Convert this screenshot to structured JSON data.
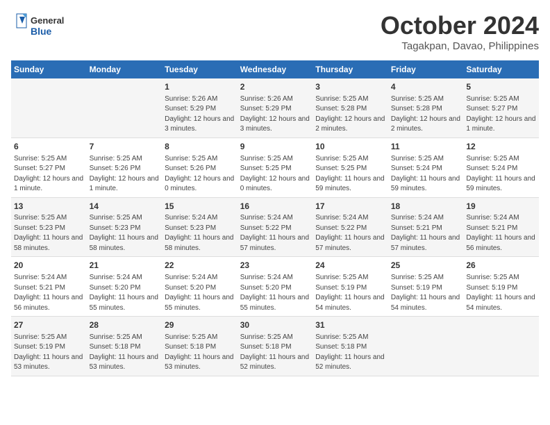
{
  "logo": {
    "line1": "General",
    "line2": "Blue"
  },
  "title": "October 2024",
  "subtitle": "Tagakpan, Davao, Philippines",
  "weekdays": [
    "Sunday",
    "Monday",
    "Tuesday",
    "Wednesday",
    "Thursday",
    "Friday",
    "Saturday"
  ],
  "weeks": [
    [
      {
        "day": "",
        "info": ""
      },
      {
        "day": "",
        "info": ""
      },
      {
        "day": "1",
        "info": "Sunrise: 5:26 AM\nSunset: 5:29 PM\nDaylight: 12 hours and 3 minutes."
      },
      {
        "day": "2",
        "info": "Sunrise: 5:26 AM\nSunset: 5:29 PM\nDaylight: 12 hours and 3 minutes."
      },
      {
        "day": "3",
        "info": "Sunrise: 5:25 AM\nSunset: 5:28 PM\nDaylight: 12 hours and 2 minutes."
      },
      {
        "day": "4",
        "info": "Sunrise: 5:25 AM\nSunset: 5:28 PM\nDaylight: 12 hours and 2 minutes."
      },
      {
        "day": "5",
        "info": "Sunrise: 5:25 AM\nSunset: 5:27 PM\nDaylight: 12 hours and 1 minute."
      }
    ],
    [
      {
        "day": "6",
        "info": "Sunrise: 5:25 AM\nSunset: 5:27 PM\nDaylight: 12 hours and 1 minute."
      },
      {
        "day": "7",
        "info": "Sunrise: 5:25 AM\nSunset: 5:26 PM\nDaylight: 12 hours and 1 minute."
      },
      {
        "day": "8",
        "info": "Sunrise: 5:25 AM\nSunset: 5:26 PM\nDaylight: 12 hours and 0 minutes."
      },
      {
        "day": "9",
        "info": "Sunrise: 5:25 AM\nSunset: 5:25 PM\nDaylight: 12 hours and 0 minutes."
      },
      {
        "day": "10",
        "info": "Sunrise: 5:25 AM\nSunset: 5:25 PM\nDaylight: 11 hours and 59 minutes."
      },
      {
        "day": "11",
        "info": "Sunrise: 5:25 AM\nSunset: 5:24 PM\nDaylight: 11 hours and 59 minutes."
      },
      {
        "day": "12",
        "info": "Sunrise: 5:25 AM\nSunset: 5:24 PM\nDaylight: 11 hours and 59 minutes."
      }
    ],
    [
      {
        "day": "13",
        "info": "Sunrise: 5:25 AM\nSunset: 5:23 PM\nDaylight: 11 hours and 58 minutes."
      },
      {
        "day": "14",
        "info": "Sunrise: 5:25 AM\nSunset: 5:23 PM\nDaylight: 11 hours and 58 minutes."
      },
      {
        "day": "15",
        "info": "Sunrise: 5:24 AM\nSunset: 5:23 PM\nDaylight: 11 hours and 58 minutes."
      },
      {
        "day": "16",
        "info": "Sunrise: 5:24 AM\nSunset: 5:22 PM\nDaylight: 11 hours and 57 minutes."
      },
      {
        "day": "17",
        "info": "Sunrise: 5:24 AM\nSunset: 5:22 PM\nDaylight: 11 hours and 57 minutes."
      },
      {
        "day": "18",
        "info": "Sunrise: 5:24 AM\nSunset: 5:21 PM\nDaylight: 11 hours and 57 minutes."
      },
      {
        "day": "19",
        "info": "Sunrise: 5:24 AM\nSunset: 5:21 PM\nDaylight: 11 hours and 56 minutes."
      }
    ],
    [
      {
        "day": "20",
        "info": "Sunrise: 5:24 AM\nSunset: 5:21 PM\nDaylight: 11 hours and 56 minutes."
      },
      {
        "day": "21",
        "info": "Sunrise: 5:24 AM\nSunset: 5:20 PM\nDaylight: 11 hours and 55 minutes."
      },
      {
        "day": "22",
        "info": "Sunrise: 5:24 AM\nSunset: 5:20 PM\nDaylight: 11 hours and 55 minutes."
      },
      {
        "day": "23",
        "info": "Sunrise: 5:24 AM\nSunset: 5:20 PM\nDaylight: 11 hours and 55 minutes."
      },
      {
        "day": "24",
        "info": "Sunrise: 5:25 AM\nSunset: 5:19 PM\nDaylight: 11 hours and 54 minutes."
      },
      {
        "day": "25",
        "info": "Sunrise: 5:25 AM\nSunset: 5:19 PM\nDaylight: 11 hours and 54 minutes."
      },
      {
        "day": "26",
        "info": "Sunrise: 5:25 AM\nSunset: 5:19 PM\nDaylight: 11 hours and 54 minutes."
      }
    ],
    [
      {
        "day": "27",
        "info": "Sunrise: 5:25 AM\nSunset: 5:19 PM\nDaylight: 11 hours and 53 minutes."
      },
      {
        "day": "28",
        "info": "Sunrise: 5:25 AM\nSunset: 5:18 PM\nDaylight: 11 hours and 53 minutes."
      },
      {
        "day": "29",
        "info": "Sunrise: 5:25 AM\nSunset: 5:18 PM\nDaylight: 11 hours and 53 minutes."
      },
      {
        "day": "30",
        "info": "Sunrise: 5:25 AM\nSunset: 5:18 PM\nDaylight: 11 hours and 52 minutes."
      },
      {
        "day": "31",
        "info": "Sunrise: 5:25 AM\nSunset: 5:18 PM\nDaylight: 11 hours and 52 minutes."
      },
      {
        "day": "",
        "info": ""
      },
      {
        "day": "",
        "info": ""
      }
    ]
  ],
  "colors": {
    "header_bg": "#2a6db5",
    "header_text": "#ffffff",
    "odd_row": "#f5f5f5",
    "even_row": "#ffffff"
  }
}
